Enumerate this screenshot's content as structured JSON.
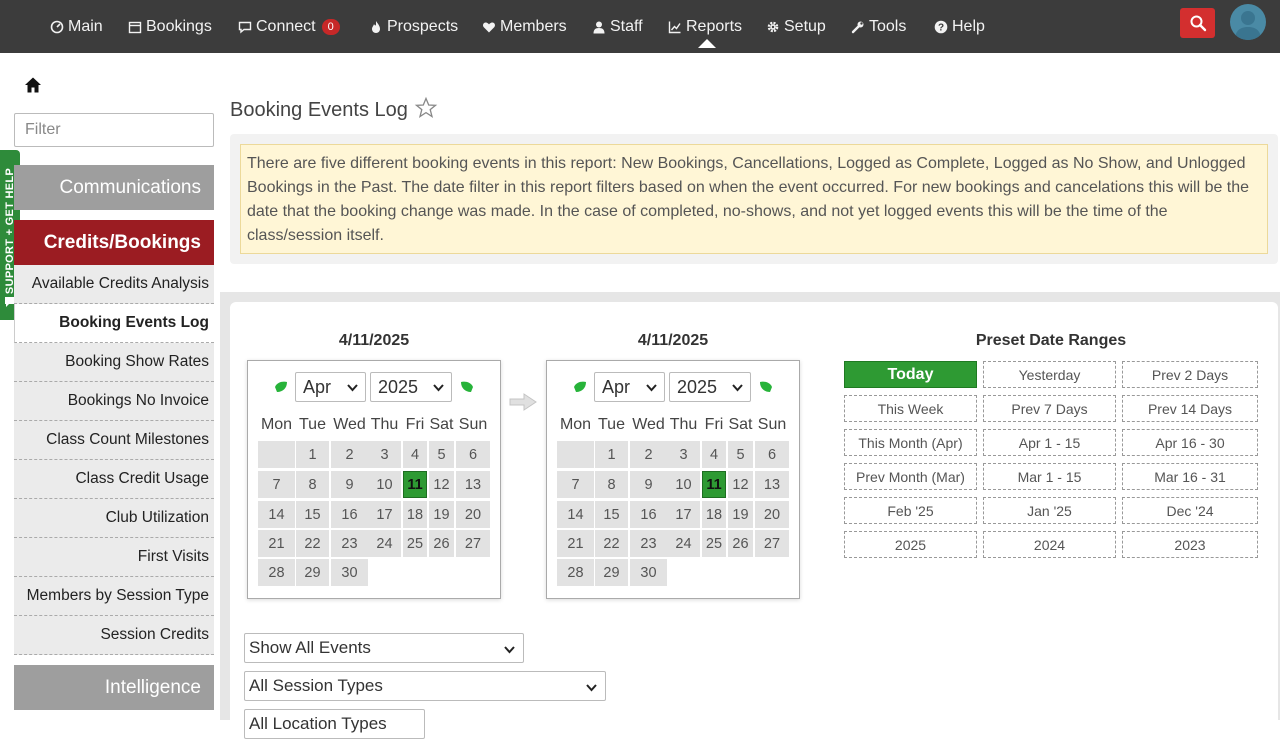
{
  "nav": {
    "items": [
      {
        "label": "Main",
        "icon": "dashboard-icon"
      },
      {
        "label": "Bookings",
        "icon": "calendar-icon"
      },
      {
        "label": "Connect",
        "icon": "chat-icon",
        "badge": "0"
      },
      {
        "label": "Prospects",
        "icon": "flame-icon"
      },
      {
        "label": "Members",
        "icon": "heart-icon"
      },
      {
        "label": "Staff",
        "icon": "person-icon"
      },
      {
        "label": "Reports",
        "icon": "chart-icon"
      },
      {
        "label": "Setup",
        "icon": "gear-icon"
      },
      {
        "label": "Tools",
        "icon": "wrench-icon"
      },
      {
        "label": "Help",
        "icon": "question-icon"
      }
    ]
  },
  "support_tab": "SUPPORT + GET HELP",
  "sidebar": {
    "filter_placeholder": "Filter",
    "sections": [
      "Communications",
      "Credits/Bookings",
      "Intelligence"
    ],
    "items": [
      "Available Credits Analysis",
      "Booking Events Log",
      "Booking Show Rates",
      "Bookings No Invoice",
      "Class Count Milestones",
      "Class Credit Usage",
      "Club Utilization",
      "First Visits",
      "Members by Session Type",
      "Session Credits"
    ],
    "active_item": "Booking Events Log"
  },
  "page": {
    "title": "Booking Events Log",
    "info": "There are five different booking events in this report: New Bookings, Cancellations, Logged as Complete, Logged as No Show, and Unlogged Bookings in the Past. The date filter in this report filters based on when the event occurred. For new bookings and cancelations this will be the date that the booking change was made. In the case of completed, no-shows, and not yet logged events this will be the time of the class/session itself."
  },
  "calendars": [
    {
      "date_label": "4/11/2025",
      "month": "Apr",
      "year": "2025",
      "selected_day": 11
    },
    {
      "date_label": "4/11/2025",
      "month": "Apr",
      "year": "2025",
      "selected_day": 11
    }
  ],
  "weekdays": [
    "Mon",
    "Tue",
    "Wed",
    "Thu",
    "Fri",
    "Sat",
    "Sun"
  ],
  "presets": {
    "title": "Preset Date Ranges",
    "buttons": [
      "Today",
      "Yesterday",
      "Prev 2 Days",
      "This Week",
      "Prev 7 Days",
      "Prev 14 Days",
      "This Month (Apr)",
      "Apr 1 - 15",
      "Apr 16 - 30",
      "Prev Month (Mar)",
      "Mar 1 - 15",
      "Mar 16 - 31",
      "Feb '25",
      "Jan '25",
      "Dec '24",
      "2025",
      "2024",
      "2023"
    ],
    "active": "Today"
  },
  "filters": {
    "events": "Show All Events",
    "session_types": "All Session Types",
    "third": "All Location Types"
  },
  "colors": {
    "nav_bg": "#3c3c3c",
    "active_section": "#9b1c22",
    "today_green": "#2e9a33",
    "support_green": "#2e8b3a"
  }
}
